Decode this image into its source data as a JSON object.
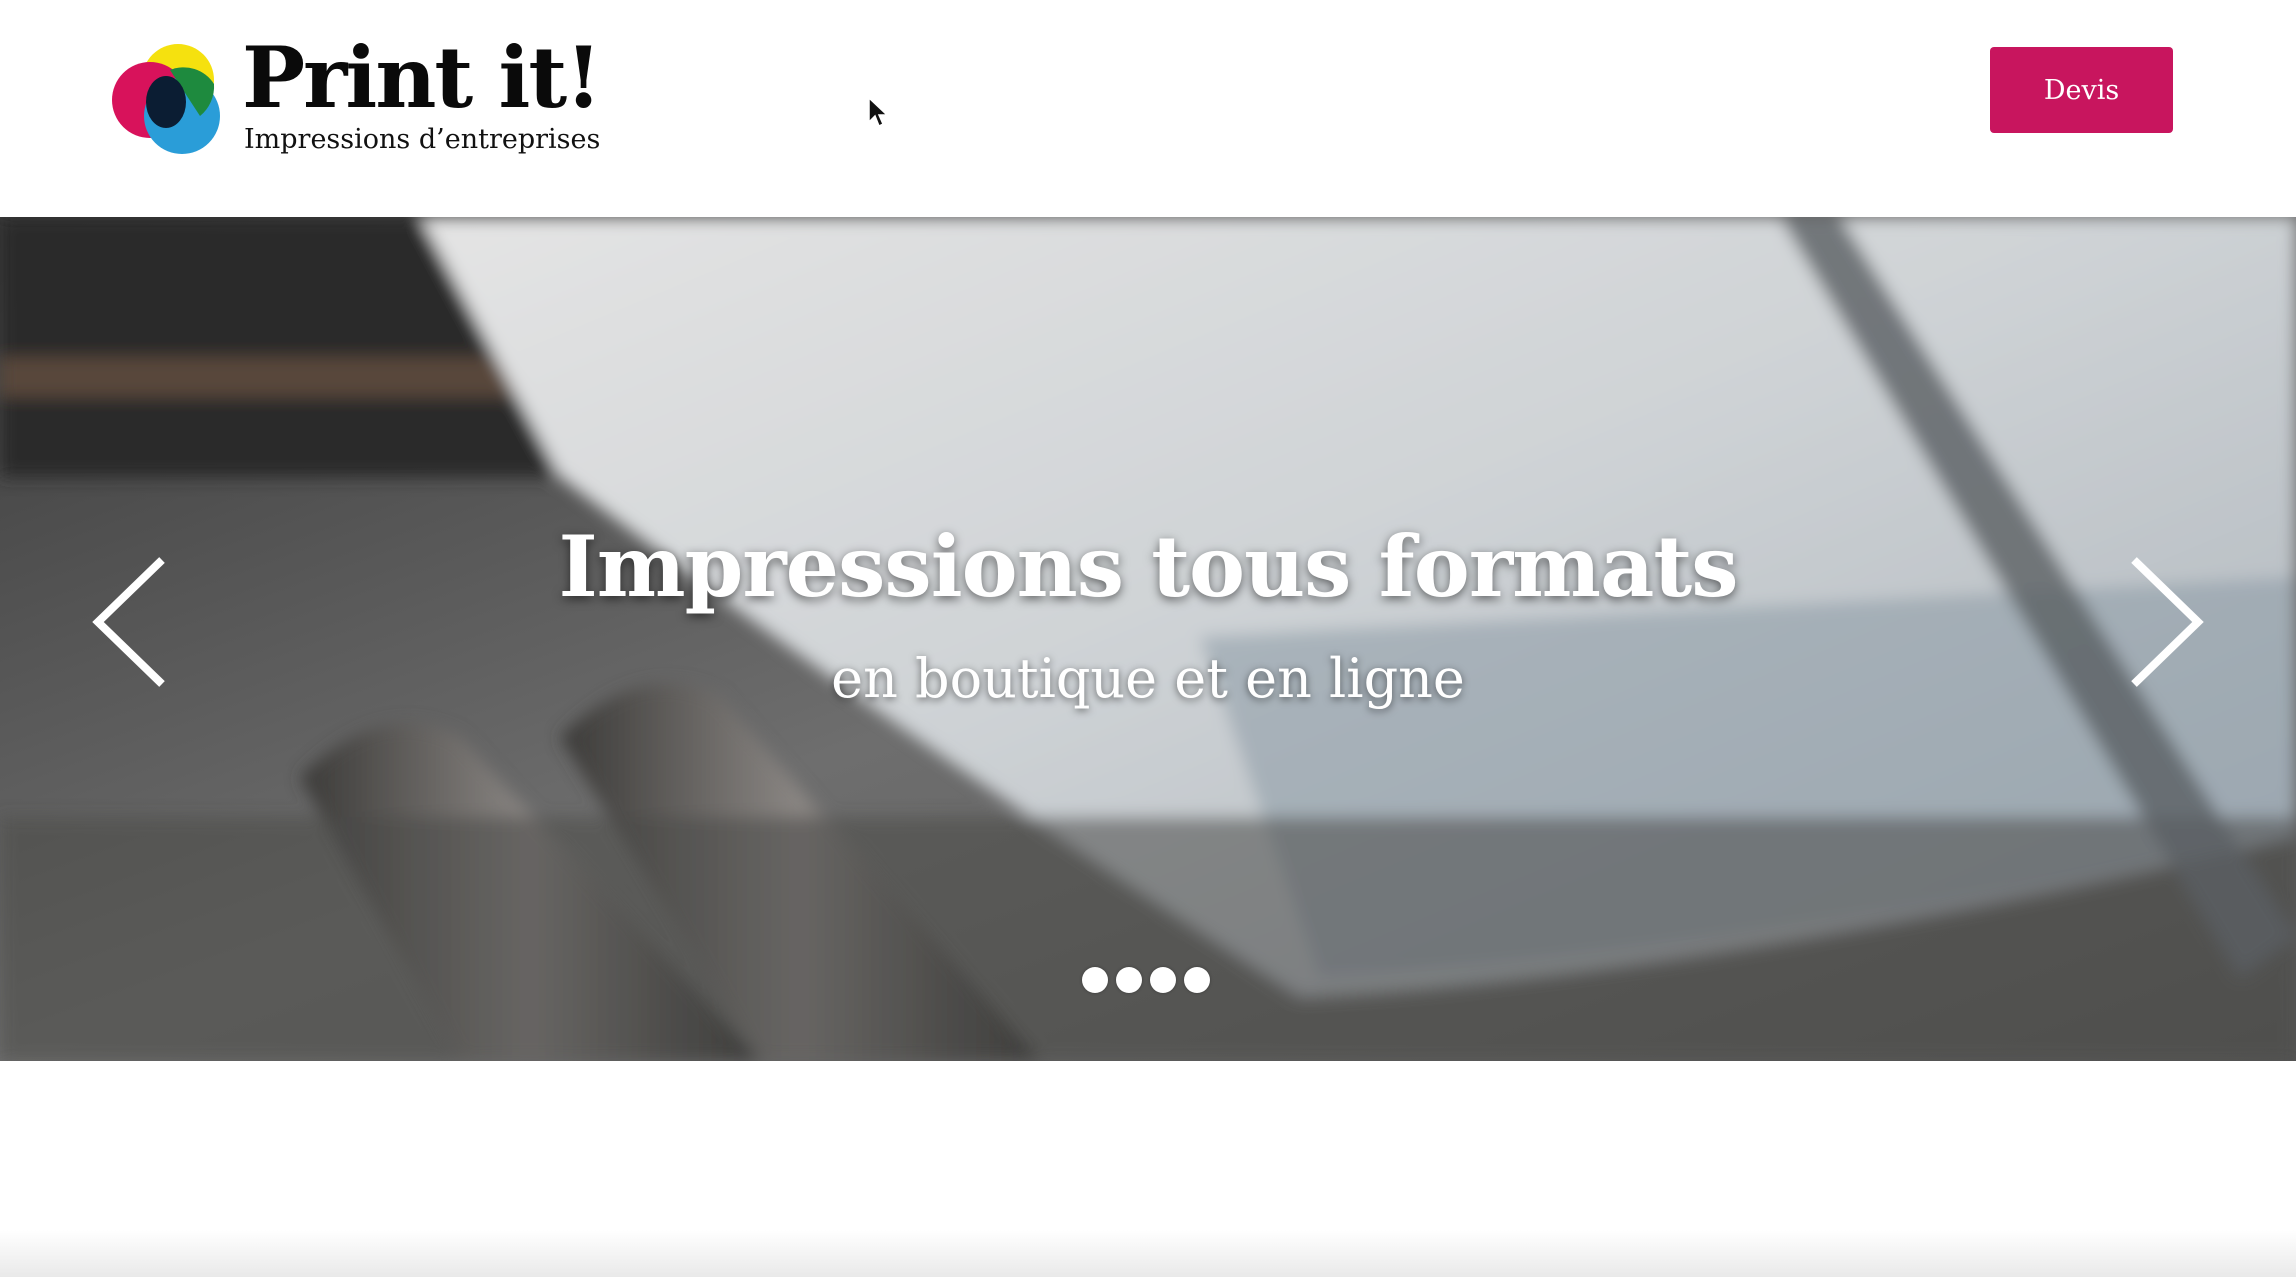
{
  "header": {
    "logo": {
      "title": "Print it!",
      "subtitle": "Impressions d’entreprises",
      "colors": [
        "#f5e10f",
        "#d8125b",
        "#2a9dd8",
        "#1e8a3e",
        "#0b1d33"
      ]
    },
    "devis_label": "Devis",
    "devis_color": "#c8155e"
  },
  "banner": {
    "title": "Impressions tous formats",
    "subtitle": "en boutique et en ligne",
    "prev_icon": "chevron-left-icon",
    "next_icon": "chevron-right-icon",
    "slides_count": 4,
    "active_slide": 1
  }
}
